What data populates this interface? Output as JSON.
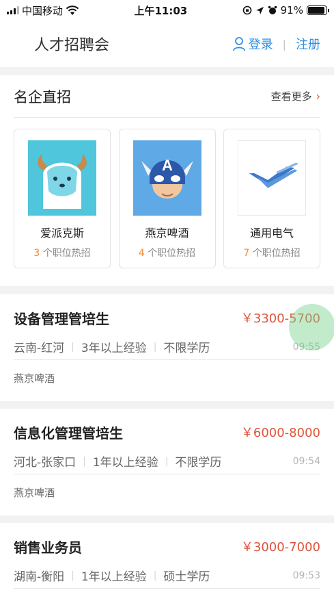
{
  "status_bar": {
    "carrier": "中国移动",
    "time": "上午11:03",
    "battery": "91%",
    "battery_level": 0.91
  },
  "nav": {
    "title": "人才招聘会",
    "login": "登录",
    "separator": "|",
    "register": "注册"
  },
  "companies": {
    "title": "名企直招",
    "more": "查看更多",
    "suffix": "个职位热招",
    "items": [
      {
        "name": "爱派克斯",
        "count": "3",
        "logo": "yeti-mascot-icon"
      },
      {
        "name": "燕京啤酒",
        "count": "4",
        "logo": "captain-mascot-icon"
      },
      {
        "name": "通用电气",
        "count": "7",
        "logo": "wing-logo-icon"
      }
    ]
  },
  "jobs": [
    {
      "title": "设备管理管培生",
      "salary": "￥3300-5700",
      "location": "云南-红河",
      "experience": "3年以上经验",
      "education": "不限学历",
      "time": "09:55",
      "company": "燕京啤酒"
    },
    {
      "title": "信息化管理管培生",
      "salary": "￥6000-8000",
      "location": "河北-张家口",
      "experience": "1年以上经验",
      "education": "不限学历",
      "time": "09:54",
      "company": "燕京啤酒"
    },
    {
      "title": "销售业务员",
      "salary": "￥3000-7000",
      "location": "湖南-衡阳",
      "experience": "1年以上经验",
      "education": "硕士学历",
      "time": "09:53"
    }
  ],
  "colors": {
    "accent_blue": "#2f8fe6",
    "salary_red": "#e0533c",
    "count_orange": "#f08a2c",
    "background": "#f2f2f2"
  }
}
